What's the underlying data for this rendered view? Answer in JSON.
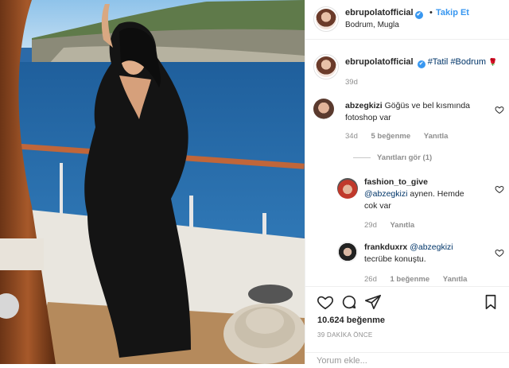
{
  "header": {
    "username": "ebrupolatofficial",
    "verified_mark": "✔",
    "separator": "•",
    "follow_label": "Takip Et",
    "location": "Bodrum, Mugla"
  },
  "caption": {
    "username": "ebrupolatofficial",
    "hashtags": [
      "#Tatil",
      "#Bodrum"
    ],
    "emoji": "🌹",
    "time": "39d"
  },
  "comments": [
    {
      "username": "abzegkizi",
      "text_line1": "Göğüs ve bel kısmında",
      "text_line2": "fotoshop var",
      "time": "34d",
      "likes": "5 beğenme",
      "reply": "Yanıtla"
    }
  ],
  "view_replies": "Yanıtları gör (1)",
  "replies": [
    {
      "username": "fashion_to_give",
      "mention": "@abzegkizi",
      "text_line1": "aynen. Hemde",
      "text_line2": "cok var",
      "time": "29d",
      "reply": "Yanıtla"
    },
    {
      "username": "frankduxrx",
      "mention": "@abzegkizi",
      "text_line2": "tecrübe konuştu.",
      "time": "26d",
      "likes": "1 beğenme",
      "reply": "Yanıtla"
    }
  ],
  "footer": {
    "likes_count": "10.624 beğenme",
    "time_ago": "39 DAKİKA ÖNCE",
    "comment_placeholder": "Yorum ekle..."
  },
  "icons": {
    "like": "heart-icon",
    "comment": "comment-icon",
    "share": "share-icon",
    "save": "bookmark-icon"
  },
  "colors": {
    "link_blue": "#3897f0",
    "hashtag": "#003569",
    "muted": "#8e8e8e"
  }
}
